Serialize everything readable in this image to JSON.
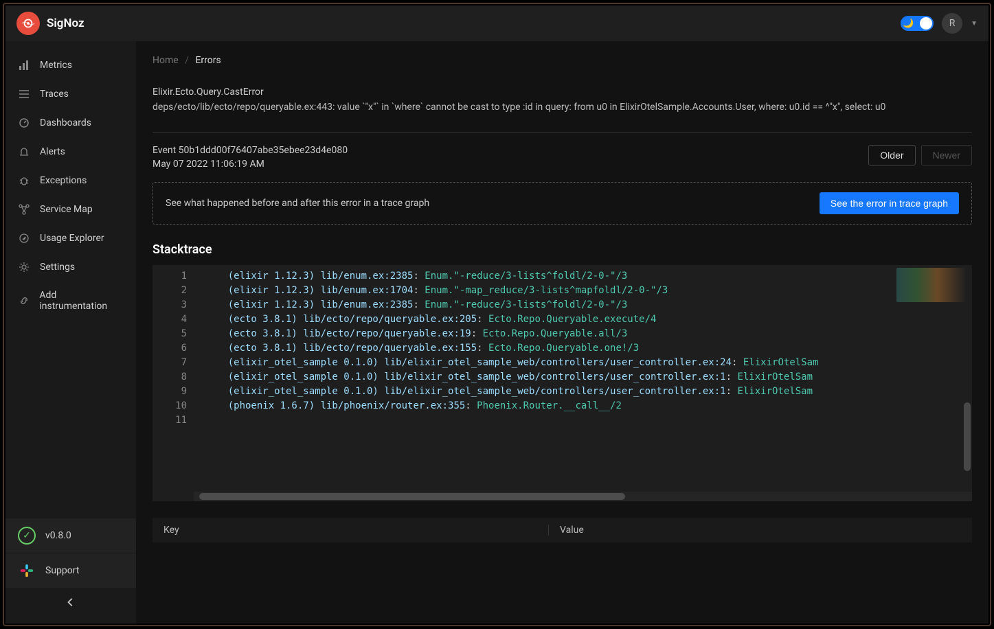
{
  "brand": "SigNoz",
  "header": {
    "avatar_initial": "R"
  },
  "sidebar": {
    "items": [
      {
        "label": "Metrics"
      },
      {
        "label": "Traces"
      },
      {
        "label": "Dashboards"
      },
      {
        "label": "Alerts"
      },
      {
        "label": "Exceptions"
      },
      {
        "label": "Service Map"
      },
      {
        "label": "Usage Explorer"
      },
      {
        "label": "Settings"
      },
      {
        "label": "Add instrumentation"
      }
    ],
    "version_label": "v0.8.0",
    "support_label": "Support"
  },
  "breadcrumb": {
    "home": "Home",
    "current": "Errors"
  },
  "error": {
    "title": "Elixir.Ecto.Query.CastError",
    "message": "deps/ecto/lib/ecto/repo/queryable.ex:443: value `\"x\"` in `where` cannot be cast to type :id in query: from u0 in ElixirOtelSample.Accounts.User, where: u0.id == ^\"x\", select: u0"
  },
  "event": {
    "id_label": "Event 50b1ddd00f76407abe35ebee23d4e080",
    "timestamp": "May 07 2022 11:06:19 AM"
  },
  "pager": {
    "older": "Older",
    "newer": "Newer"
  },
  "trace_banner": {
    "message": "See what happened before and after this error in a trace graph",
    "button": "See the error in trace graph"
  },
  "stacktrace": {
    "title": "Stacktrace",
    "lines": [
      {
        "n": 1,
        "loc": "(elixir 1.12.3) lib/enum.ex:2385",
        "fn": "Enum.\"-reduce/3-lists^foldl/2-0-\"/3"
      },
      {
        "n": 2,
        "loc": "(elixir 1.12.3) lib/enum.ex:1704",
        "fn": "Enum.\"-map_reduce/3-lists^mapfoldl/2-0-\"/3"
      },
      {
        "n": 3,
        "loc": "(elixir 1.12.3) lib/enum.ex:2385",
        "fn": "Enum.\"-reduce/3-lists^foldl/2-0-\"/3"
      },
      {
        "n": 4,
        "loc": "(ecto 3.8.1) lib/ecto/repo/queryable.ex:205",
        "fn": "Ecto.Repo.Queryable.execute/4"
      },
      {
        "n": 5,
        "loc": "(ecto 3.8.1) lib/ecto/repo/queryable.ex:19",
        "fn": "Ecto.Repo.Queryable.all/3"
      },
      {
        "n": 6,
        "loc": "(ecto 3.8.1) lib/ecto/repo/queryable.ex:155",
        "fn": "Ecto.Repo.Queryable.one!/3"
      },
      {
        "n": 7,
        "loc": "(elixir_otel_sample 0.1.0) lib/elixir_otel_sample_web/controllers/user_controller.ex:24",
        "fn": "ElixirOtelSam"
      },
      {
        "n": 8,
        "loc": "(elixir_otel_sample 0.1.0) lib/elixir_otel_sample_web/controllers/user_controller.ex:1",
        "fn": "ElixirOtelSam"
      },
      {
        "n": 9,
        "loc": "(elixir_otel_sample 0.1.0) lib/elixir_otel_sample_web/controllers/user_controller.ex:1",
        "fn": "ElixirOtelSam"
      },
      {
        "n": 10,
        "loc": "(phoenix 1.6.7) lib/phoenix/router.ex:355",
        "fn": "Phoenix.Router.__call__/2"
      },
      {
        "n": 11,
        "loc": "",
        "fn": ""
      }
    ]
  },
  "kv_table": {
    "key_header": "Key",
    "value_header": "Value"
  }
}
